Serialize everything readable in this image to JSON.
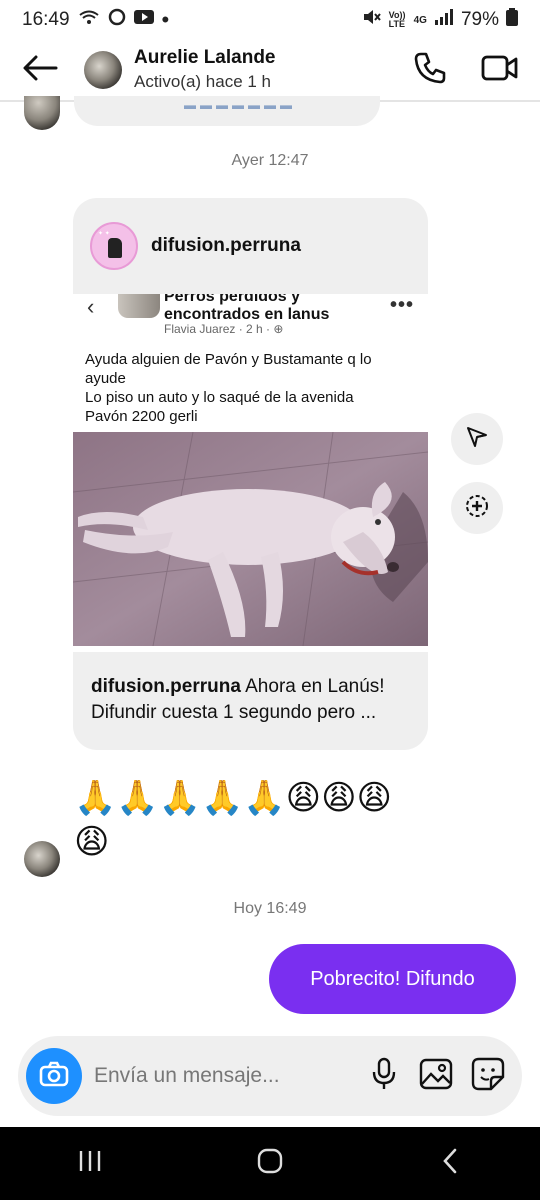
{
  "status_bar": {
    "time": "16:49",
    "battery": "79%",
    "network_volte": "Vo)) LTE",
    "network_type": "4G"
  },
  "header": {
    "name": "Aurelie Lalande",
    "status": "Activo(a) hace 1 h"
  },
  "messages": {
    "timestamp_1": "Ayer 12:47",
    "shared_post": {
      "username": "difusion.perruna",
      "inner_group": "Perros perdidos y encontrados en lanus",
      "inner_meta": "Flavia Juarez · 2 h · ⊕",
      "inner_text_lines": [
        "Ayuda alguien de Pavón y Bustamante q lo",
        "ayude",
        "Lo piso un auto y lo saqué de la avenida",
        "Pavón 2200 gerli"
      ],
      "caption_user": "difusion.perruna",
      "caption_text": " Ahora en Lanús! Difundir cuesta 1 segundo pero ..."
    },
    "emoji_reply": "🙏🙏🙏🙏🙏😩😩😩😩",
    "timestamp_2": "Hoy 16:49",
    "own_message": "Pobrecito! Difundo"
  },
  "composer": {
    "placeholder": "Envía un mensaje..."
  },
  "icons": {
    "back": "arrow-left-icon",
    "call": "phone-icon",
    "video": "video-camera-icon",
    "share": "send-icon",
    "add": "add-circle-icon",
    "camera": "camera-icon",
    "mic": "microphone-icon",
    "gallery": "image-icon",
    "sticker": "sticker-icon"
  },
  "colors": {
    "accent_bubble": "#7a2ff0",
    "camera_button": "#1e90ff"
  }
}
